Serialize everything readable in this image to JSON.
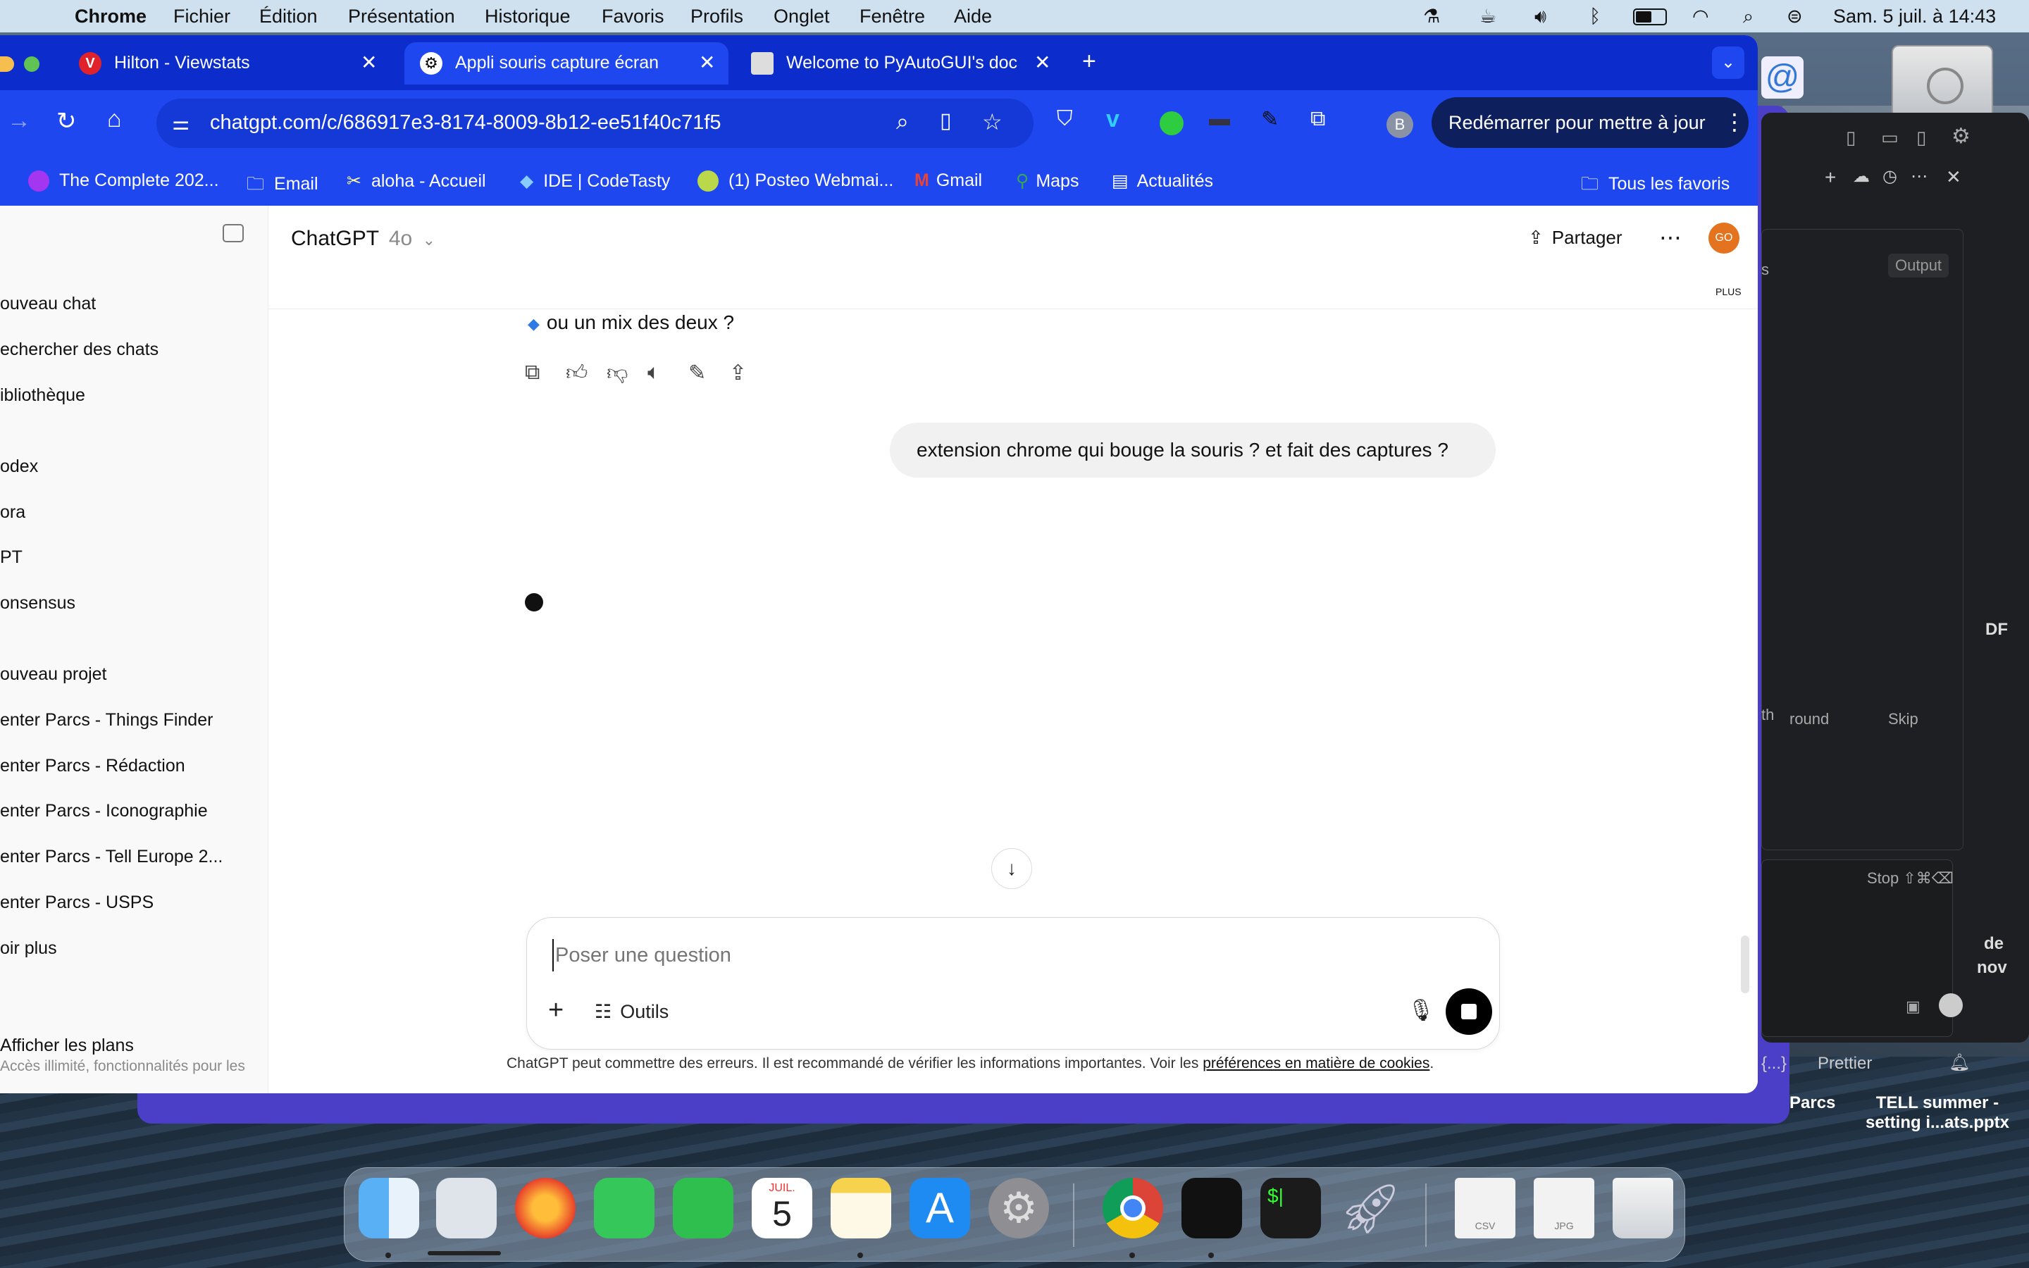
{
  "menubar": {
    "app": "Chrome",
    "items": [
      "Fichier",
      "Édition",
      "Présentation",
      "Historique",
      "Favoris",
      "Profils",
      "Onglet",
      "Fenêtre",
      "Aide"
    ],
    "datetime": "Sam. 5 juil. à  14:43"
  },
  "tabs": [
    {
      "label": "Hilton - Viewstats"
    },
    {
      "label": "Appli souris capture écran"
    },
    {
      "label": "Welcome to PyAutoGUI's doc"
    }
  ],
  "omnibox": {
    "url": "chatgpt.com/c/686917e3-8174-8009-8b12-ee51f40c71f5"
  },
  "toolbar": {
    "profile_initial": "B",
    "update_label": "Redémarrer pour mettre à jour"
  },
  "bookmarks": [
    {
      "label": "The Complete 202..."
    },
    {
      "label": "Email"
    },
    {
      "label": "aloha - Accueil"
    },
    {
      "label": "IDE | CodeTasty"
    },
    {
      "label": "(1) Posteo Webmai..."
    },
    {
      "label": "Gmail"
    },
    {
      "label": "Maps"
    },
    {
      "label": "Actualités"
    }
  ],
  "bookmarks_all": "Tous les favoris",
  "sidebar": {
    "items": [
      {
        "label": "ouveau chat"
      },
      {
        "label": "echercher des chats"
      },
      {
        "label": "ibliothèque"
      },
      {
        "label": "odex"
      },
      {
        "label": "ora"
      },
      {
        "label": "PT"
      },
      {
        "label": "onsensus"
      },
      {
        "label": "ouveau projet"
      },
      {
        "label": "enter Parcs - Things Finder"
      },
      {
        "label": "enter Parcs - Rédaction"
      },
      {
        "label": "enter Parcs - Iconographie"
      },
      {
        "label": "enter Parcs - Tell Europe 2..."
      },
      {
        "label": "enter Parcs - USPS"
      },
      {
        "label": "oir plus"
      }
    ],
    "plans_title": "Afficher les plans",
    "plans_sub": "Accès illimité, fonctionnalités pour les"
  },
  "header": {
    "title": "ChatGPT",
    "model": "4o",
    "share": "Partager",
    "avatar_initials": "GO",
    "avatar_badge": "PLUS"
  },
  "conversation": {
    "assistant_tail": "ou un mix des deux ?",
    "user_message": "extension chrome qui bouge la souris ? et fait des captures ?"
  },
  "composer": {
    "placeholder": "Poser une question",
    "tools_label": "Outils"
  },
  "disclaimer": {
    "text": "ChatGPT peut commettre des erreurs. Il est recommandé de vérifier les informations importantes. Voir les ",
    "link": "préférences en matière de cookies",
    "end": "."
  },
  "right_panel": {
    "output": "Output",
    "round": "round",
    "skip": "Skip",
    "stop": "Stop ⇧⌘⌫",
    "braces": "{...}",
    "prettier": "Prettier",
    "frag_th": "th",
    "frag_df": "DF",
    "frag_de": "de",
    "frag_nov": "nov",
    "frag_s": "s"
  },
  "desktop": {
    "file1": "Parcs",
    "file2_line1": "TELL summer -",
    "file2_line2": "setting i...ats.pptx"
  },
  "dock": {
    "calendar_month": "JUIL.",
    "calendar_day": "5",
    "csv_label": "CSV",
    "jpg_label": "JPG"
  },
  "colors": {
    "chrome_blue": "#1f47f0",
    "tabbar_blue": "#0c2ccc",
    "purple_window": "#4b3fc7",
    "avatar_orange": "#e3731e"
  }
}
